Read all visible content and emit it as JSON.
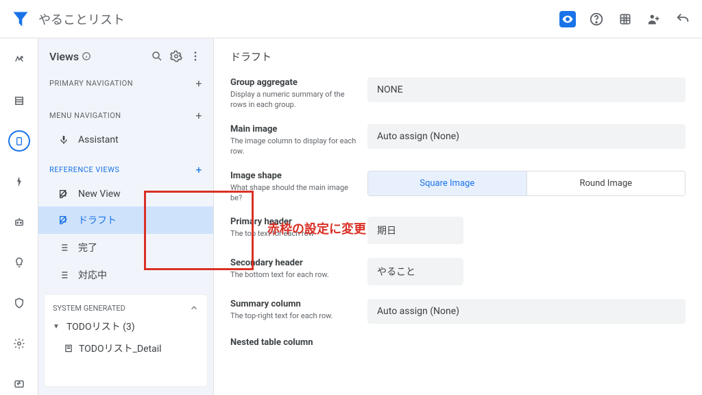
{
  "app": {
    "title": "やることリスト"
  },
  "views_panel": {
    "title": "Views",
    "sections": {
      "primary_nav": "PRIMARY NAVIGATION",
      "menu_nav": "MENU NAVIGATION",
      "ref_views": "REFERENCE VIEWS",
      "sys_gen": "SYSTEM GENERATED"
    },
    "assistant": "Assistant",
    "ref_items": {
      "new_view": "New View",
      "draft": "ドラフト",
      "done": "完了",
      "in_progress": "対応中"
    },
    "sys_tree": {
      "root": "TODOリスト (3)",
      "child": "TODOリスト_Detail"
    }
  },
  "content": {
    "title": "ドラフト",
    "fields": {
      "group_aggregate": {
        "label": "Group aggregate",
        "desc": "Display a numeric summary of the rows in each group.",
        "value": "NONE"
      },
      "main_image": {
        "label": "Main image",
        "desc": "The image column to display for each row.",
        "value": "Auto assign (None)"
      },
      "image_shape": {
        "label": "Image shape",
        "desc": "What shape should the main image be?",
        "opt_square": "Square Image",
        "opt_round": "Round Image"
      },
      "primary_header": {
        "label": "Primary header",
        "desc": "The top text for each row",
        "value": "期日"
      },
      "secondary_header": {
        "label": "Secondary header",
        "desc": "The bottom text for each row.",
        "value": "やること"
      },
      "summary_column": {
        "label": "Summary column",
        "desc": "The top-right text for each row.",
        "value": "Auto assign (None)"
      },
      "nested_table": {
        "label": "Nested table column"
      }
    },
    "annotation": "赤枠の設定に変更"
  }
}
